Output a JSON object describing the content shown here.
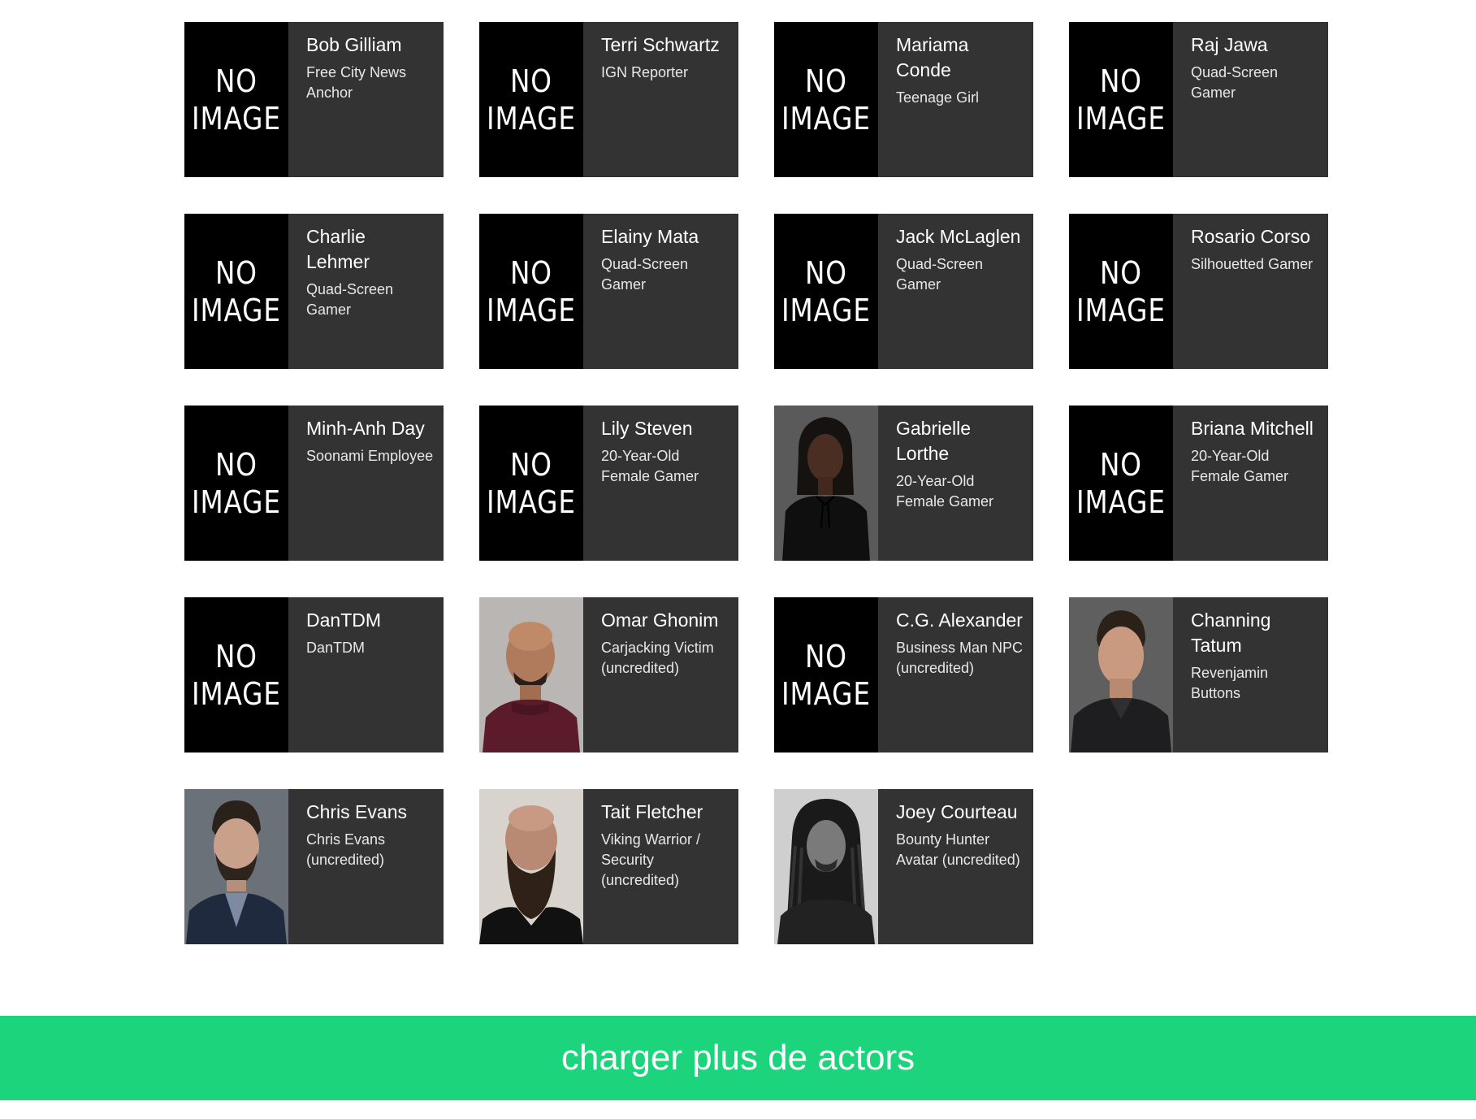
{
  "placeholder_text": [
    "NO",
    "IMAGE"
  ],
  "cast": [
    {
      "name": "Bob Gilliam",
      "role": "Free City News Anchor",
      "photo": null
    },
    {
      "name": "Terri Schwartz",
      "role": "IGN Reporter",
      "photo": null
    },
    {
      "name": "Mariama Conde",
      "role": "Teenage Girl",
      "photo": null
    },
    {
      "name": "Raj Jawa",
      "role": "Quad-Screen Gamer",
      "photo": null
    },
    {
      "name": "Charlie Lehmer",
      "role": "Quad-Screen Gamer",
      "photo": null
    },
    {
      "name": "Elainy Mata",
      "role": "Quad-Screen Gamer",
      "photo": null
    },
    {
      "name": "Jack McLaglen",
      "role": "Quad-Screen Gamer",
      "photo": null
    },
    {
      "name": "Rosario Corso",
      "role": "Silhouetted Gamer",
      "photo": null
    },
    {
      "name": "Minh-Anh Day",
      "role": "Soonami Employee",
      "photo": null
    },
    {
      "name": "Lily Steven",
      "role": "20-Year-Old Female Gamer",
      "photo": null
    },
    {
      "name": "Gabrielle Lorthe",
      "role": "20-Year-Old Female Gamer",
      "photo": "portrait-woman-black-top"
    },
    {
      "name": "Briana Mitchell",
      "role": "20-Year-Old Female Gamer",
      "photo": null
    },
    {
      "name": "DanTDM",
      "role": "DanTDM",
      "photo": null
    },
    {
      "name": "Omar Ghonim",
      "role": "Carjacking Victim (uncredited)",
      "photo": "portrait-bald-man-maroon-sweater"
    },
    {
      "name": "C.G. Alexander",
      "role": "Business Man NPC (uncredited)",
      "photo": null
    },
    {
      "name": "Channing Tatum",
      "role": "Revenjamin Buttons",
      "photo": "portrait-man-dark-jacket"
    },
    {
      "name": "Chris Evans",
      "role": "Chris Evans (uncredited)",
      "photo": "portrait-bearded-man-navy-jacket"
    },
    {
      "name": "Tait Fletcher",
      "role": "Viking Warrior / Security (uncredited)",
      "photo": "portrait-bald-bearded-man"
    },
    {
      "name": "Joey Courteau",
      "role": "Bounty Hunter Avatar (uncredited)",
      "photo": "portrait-man-dreadlocks-bw"
    }
  ],
  "load_more": {
    "label": "charger plus de actors"
  },
  "colors": {
    "card_bg": "#333333",
    "placeholder_bg": "#000000",
    "button_bg": "#1bd47b",
    "text": "#ffffff"
  }
}
